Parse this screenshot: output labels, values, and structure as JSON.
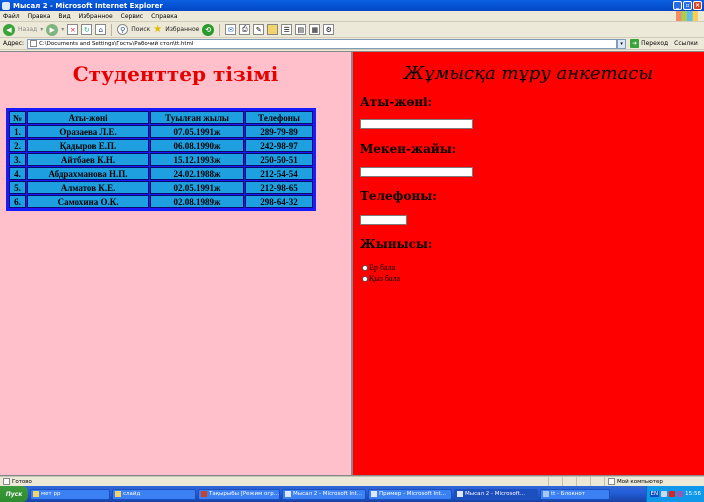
{
  "window": {
    "title": "Мысал 2 - Microsoft Internet Explorer"
  },
  "menu": [
    "Файл",
    "Правка",
    "Вид",
    "Избранное",
    "Сервис",
    "Справка"
  ],
  "toolbar": {
    "back": "Назад",
    "search": "Поиск",
    "favorites": "Избранное"
  },
  "address": {
    "label": "Адрес:",
    "value": "C:\\Documents and Settings\\Гость\\Рабочий стол\\tt.html",
    "go": "Переход",
    "links": "Ссылки"
  },
  "left": {
    "title": "Студенттер тізімі",
    "table": {
      "headers": [
        "№",
        "Аты-жөні",
        "Туылған жылы",
        "Телефоны"
      ],
      "rows": [
        [
          "1.",
          "Оразаева Л.Е.",
          "07.05.1991ж",
          "289-79-89"
        ],
        [
          "2.",
          "Қадыров Е.П.",
          "06.08.1990ж",
          "242-98-97"
        ],
        [
          "3.",
          "Айтбаев К.Н.",
          "15.12.1993ж",
          "250-50-51"
        ],
        [
          "4.",
          "Абдрахманова Н.П.",
          "24.02.1988ж",
          "212-54-54"
        ],
        [
          "5.",
          "Алматов К.Е.",
          "02.05.1991ж",
          "212-98-65"
        ],
        [
          "6.",
          "Самохина О.К.",
          "02.08.1989ж",
          "298-64-32"
        ]
      ]
    }
  },
  "right": {
    "title": "Жұмысқа тұру анкетасы",
    "name_label": "Аты-жөні:",
    "address_label": "Мекен-жайы:",
    "phone_label": "Телефоны:",
    "gender_label": "Жынысы:",
    "gender_options": [
      "Ер бала",
      "Қыз бала"
    ]
  },
  "status": {
    "text": "Готово",
    "zone": "Мой компьютер"
  },
  "taskbar": {
    "start": "Пуск",
    "tasks": [
      "мет рр",
      "слайд",
      "Тақырыбы [Режим огр...",
      "Мысал 2 - Microsoft Int...",
      "Пример - Microsoft Int...",
      "Мысал 2 - Microsoft...",
      "tt - Блокнот"
    ],
    "lang": "EN",
    "clock": "15:56"
  }
}
